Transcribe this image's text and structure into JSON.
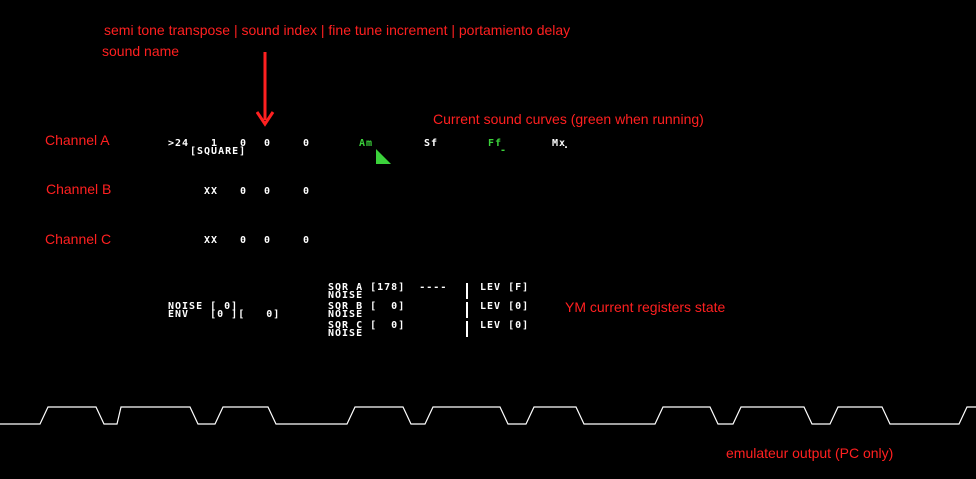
{
  "annotations": {
    "header_fields": "semi tone transpose  | sound index  | fine tune increment  |  portamiento delay",
    "sound_name": "sound name",
    "channel_a": "Channel A",
    "channel_b": "Channel B",
    "channel_c": "Channel C",
    "curves": "Current sound curves (green when running)",
    "registers": "YM current registers state",
    "emulator": "emulateur output (PC only)"
  },
  "colors": {
    "annotation": "#ff2020",
    "screen_text": "#ffffff",
    "running_curve": "#3bd23b",
    "background": "#000000"
  },
  "channels": {
    "a": {
      "transpose": ">24",
      "sound_index": "1",
      "fine_tune": "0",
      "value4": "0",
      "portamento": "0",
      "sound_name": "[SQUARE]",
      "curves": {
        "am": "Am",
        "sf": "Sf",
        "ff": "Ff",
        "mx": "Mx",
        "ff_mark": "-",
        "mx_mark": "."
      }
    },
    "b": {
      "transpose": "XX",
      "fine_tune": "0",
      "value4": "0",
      "portamento": "0"
    },
    "c": {
      "transpose": "XX",
      "fine_tune": "0",
      "value4": "0",
      "portamento": "0"
    }
  },
  "registers": {
    "noise": "NOISE [ 0]",
    "env": "ENV   [0 ][   0]",
    "sqr_a": "SQR A [178]  ----",
    "sqr_a_noise": "NOISE",
    "sqr_b": "SQR B [  0]",
    "sqr_b_noise": "NOISE",
    "sqr_c": "SQR C [  0]",
    "sqr_c_noise": "NOISE",
    "lev_a": "LEV [F]",
    "lev_b": "LEV [0]",
    "lev_c": "LEV [0]"
  }
}
